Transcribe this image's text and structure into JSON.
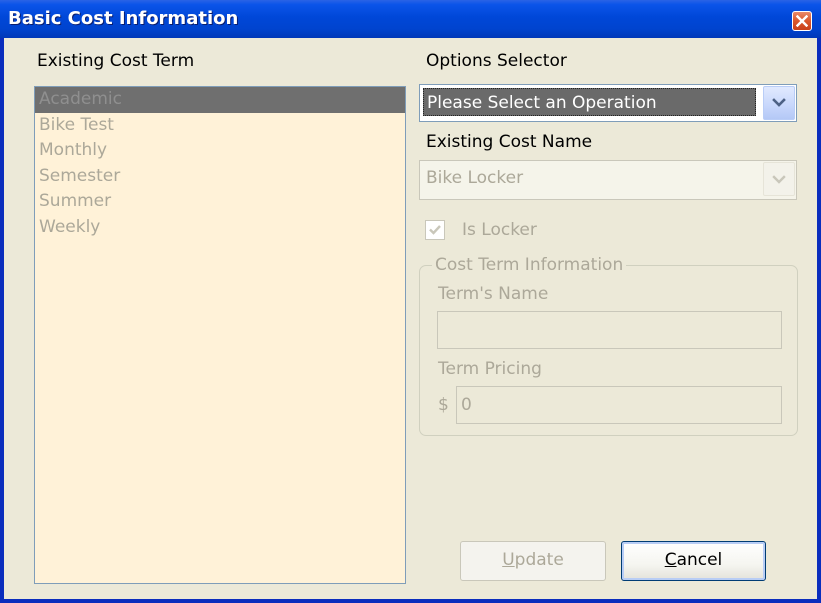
{
  "window": {
    "title": "Basic Cost Information",
    "close_icon": "close-icon"
  },
  "existing_cost_term": {
    "label": "Existing Cost Term",
    "items": [
      "Academic",
      "Bike Test",
      "Monthly",
      "Semester",
      "Summer",
      "Weekly"
    ],
    "selected": "Academic"
  },
  "options_selector": {
    "label": "Options Selector",
    "value": "Please Select an Operation"
  },
  "existing_cost_name": {
    "label": "Existing Cost Name",
    "value": "Bike Locker"
  },
  "is_locker": {
    "label": "Is Locker",
    "checked": true
  },
  "cost_term_information": {
    "title": "Cost Term Information",
    "terms_name_label": "Term's Name",
    "terms_name_value": "",
    "term_pricing_label": "Term Pricing",
    "currency_symbol": "$",
    "term_pricing_value": "0"
  },
  "buttons": {
    "update_first": "U",
    "update_rest": "pdate",
    "cancel_first": "C",
    "cancel_rest": "ancel"
  },
  "colors": {
    "title_bar": "#0047d8",
    "dialog_background": "#ece9d8",
    "list_background": "#fff2d8",
    "disabled_text": "#aca899"
  }
}
